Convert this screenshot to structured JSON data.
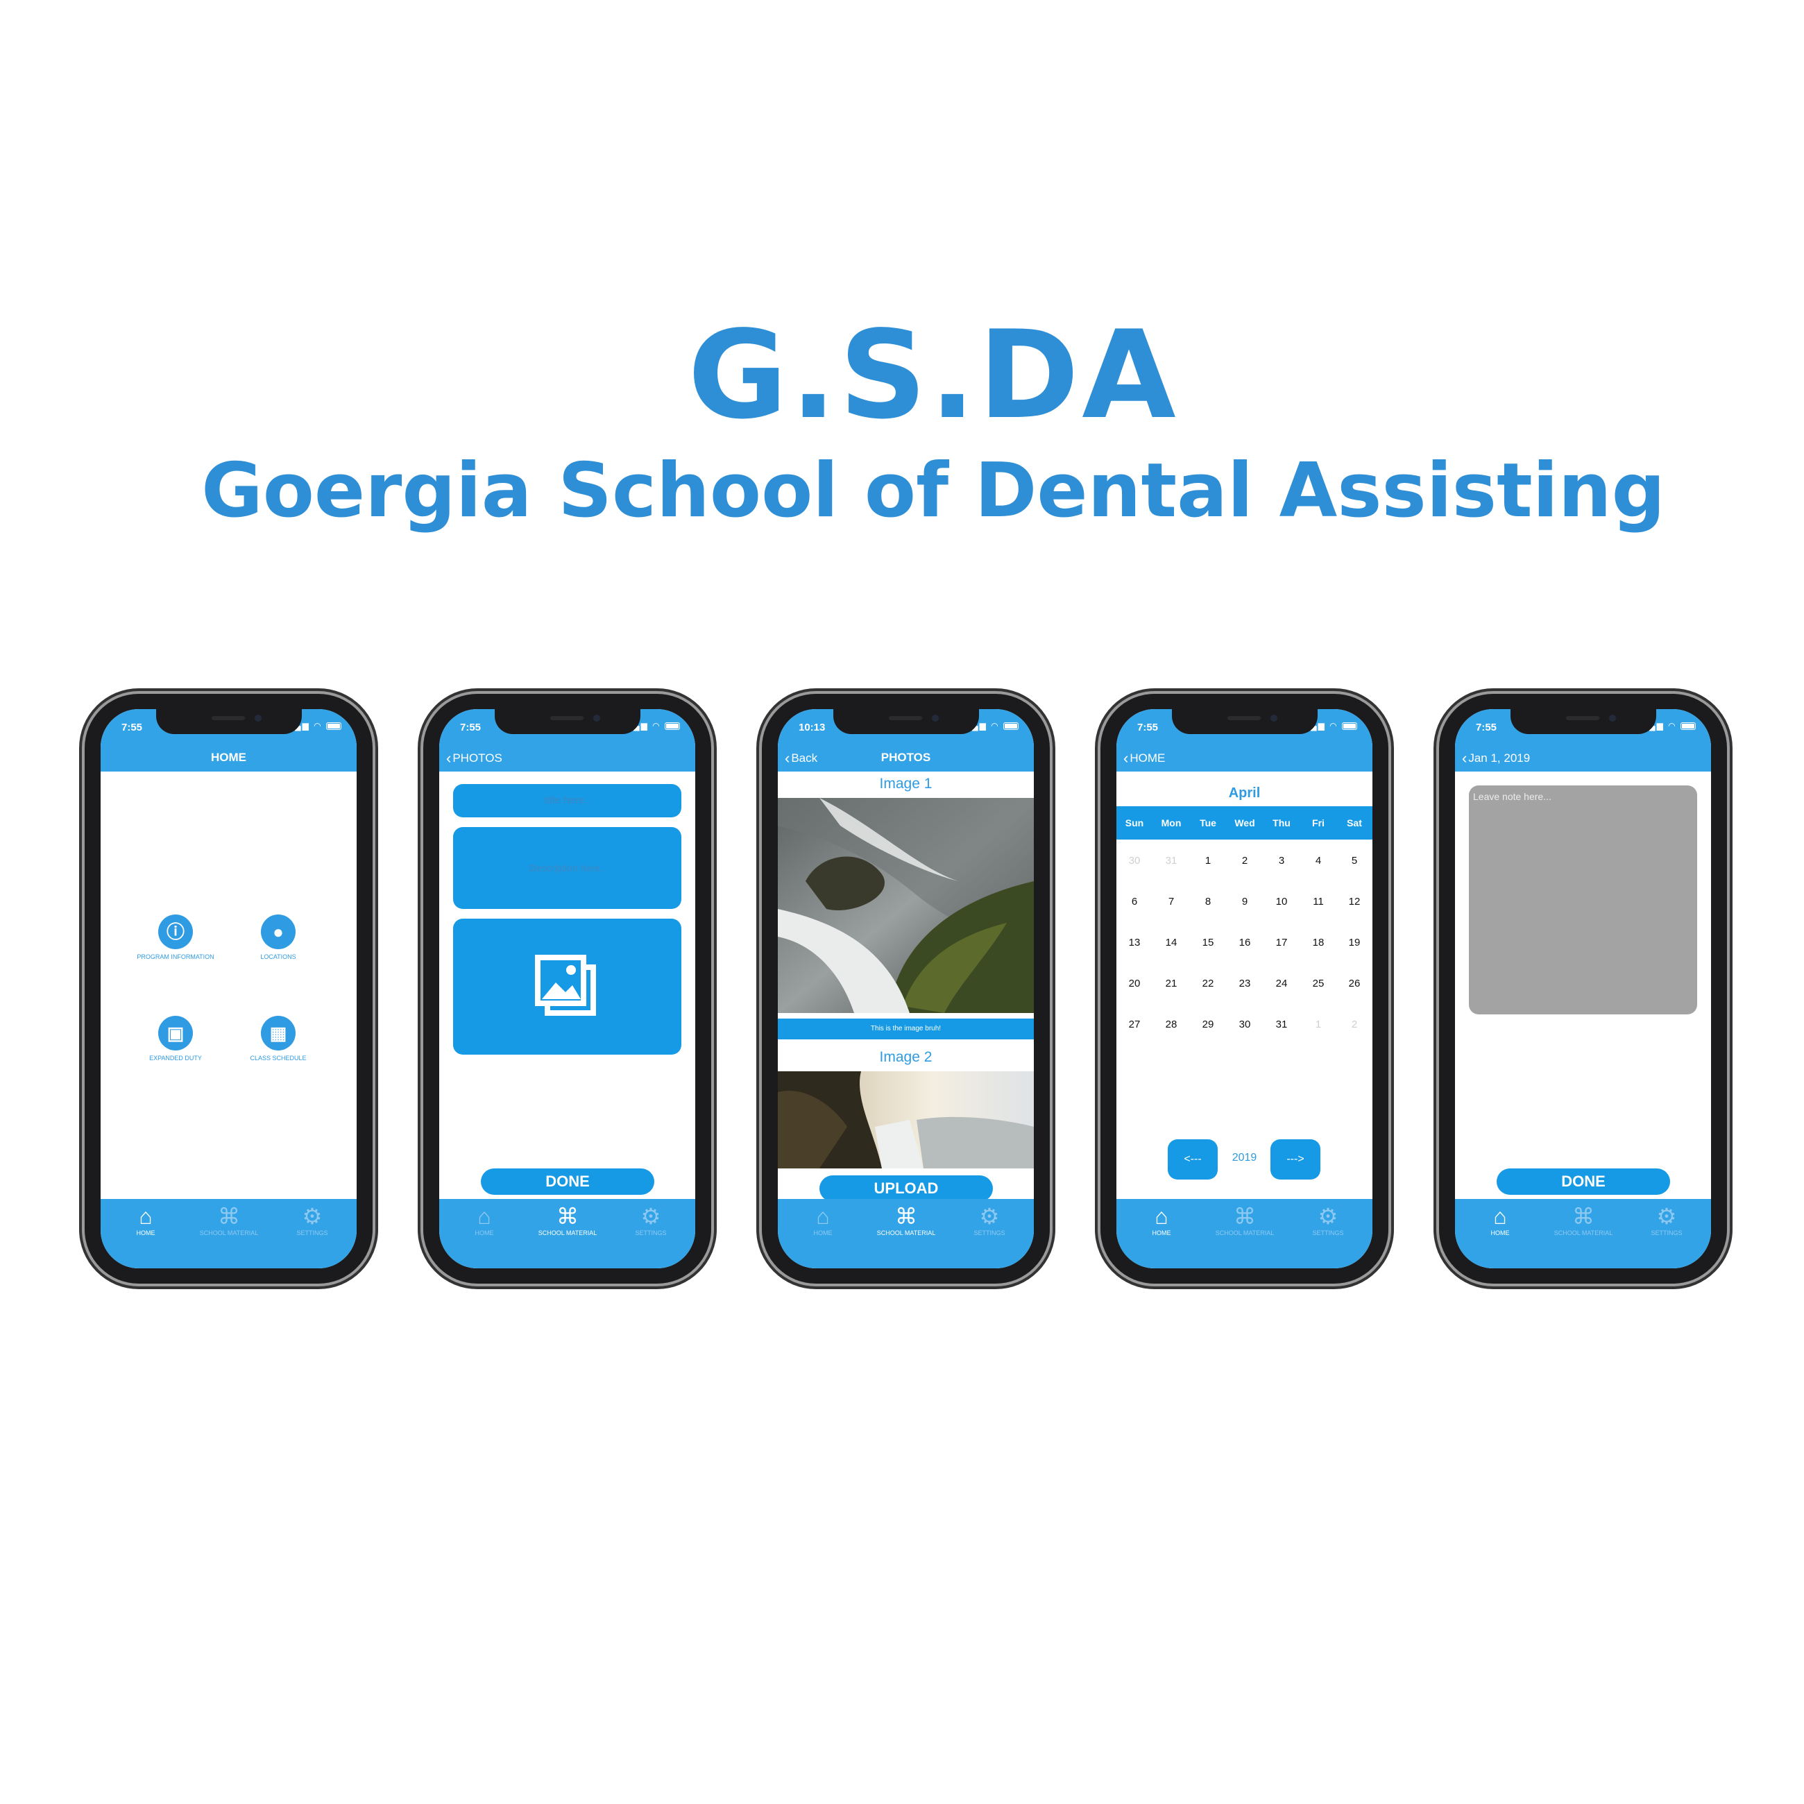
{
  "heading": {
    "title": "G.S.DA",
    "subtitle": "Goergia School of Dental Assisting"
  },
  "colors": {
    "brand_blue": "#2f8fd6",
    "header_blue": "#33a3e8",
    "button_blue": "#169ae5",
    "note_gray": "#a3a3a3"
  },
  "tabbar": {
    "home": "HOME",
    "school_material": "SCHOOL MATERIAL",
    "settings": "SETTINGS",
    "icons": [
      "house-icon",
      "school-building-icon",
      "gears-icon"
    ]
  },
  "screens": {
    "home": {
      "time": "7:55",
      "title": "HOME",
      "items": [
        {
          "label": "PROGRAM INFORMATION",
          "icon": "info-icon"
        },
        {
          "label": "LOCATIONS",
          "icon": "map-pin-icon"
        },
        {
          "label": "EXPANDED DUTY",
          "icon": "briefcase-icon"
        },
        {
          "label": "CLASS SCHEDULE",
          "icon": "calendar-icon"
        }
      ]
    },
    "add_photo": {
      "time": "7:55",
      "back_label": "PHOTOS",
      "title_placeholder": "title here..",
      "description_placeholder": "Description here..",
      "image_placeholder_icon": "photo-gallery-icon",
      "done": "DONE"
    },
    "photos": {
      "time": "10:13",
      "back_label": "Back",
      "title": "PHOTOS",
      "image1_title": "Image 1",
      "image1_caption": "This is the image bruh!",
      "image2_title": "Image 2",
      "upload": "UPLOAD"
    },
    "calendar": {
      "time": "7:55",
      "back_label": "HOME",
      "month": "April",
      "weekdays": [
        "Sun",
        "Mon",
        "Tue",
        "Wed",
        "Thu",
        "Fri",
        "Sat"
      ],
      "weeks": [
        [
          "30",
          "31",
          "1",
          "2",
          "3",
          "4",
          "5"
        ],
        [
          "6",
          "7",
          "8",
          "9",
          "10",
          "11",
          "12"
        ],
        [
          "13",
          "14",
          "15",
          "16",
          "17",
          "18",
          "19"
        ],
        [
          "20",
          "21",
          "22",
          "23",
          "24",
          "25",
          "26"
        ],
        [
          "27",
          "28",
          "29",
          "30",
          "31",
          "1",
          "2"
        ]
      ],
      "prev": "<---",
      "next": "--->",
      "year": "2019"
    },
    "note": {
      "time": "7:55",
      "back_label": "Jan 1, 2019",
      "placeholder": "Leave note here...",
      "done": "DONE"
    }
  }
}
